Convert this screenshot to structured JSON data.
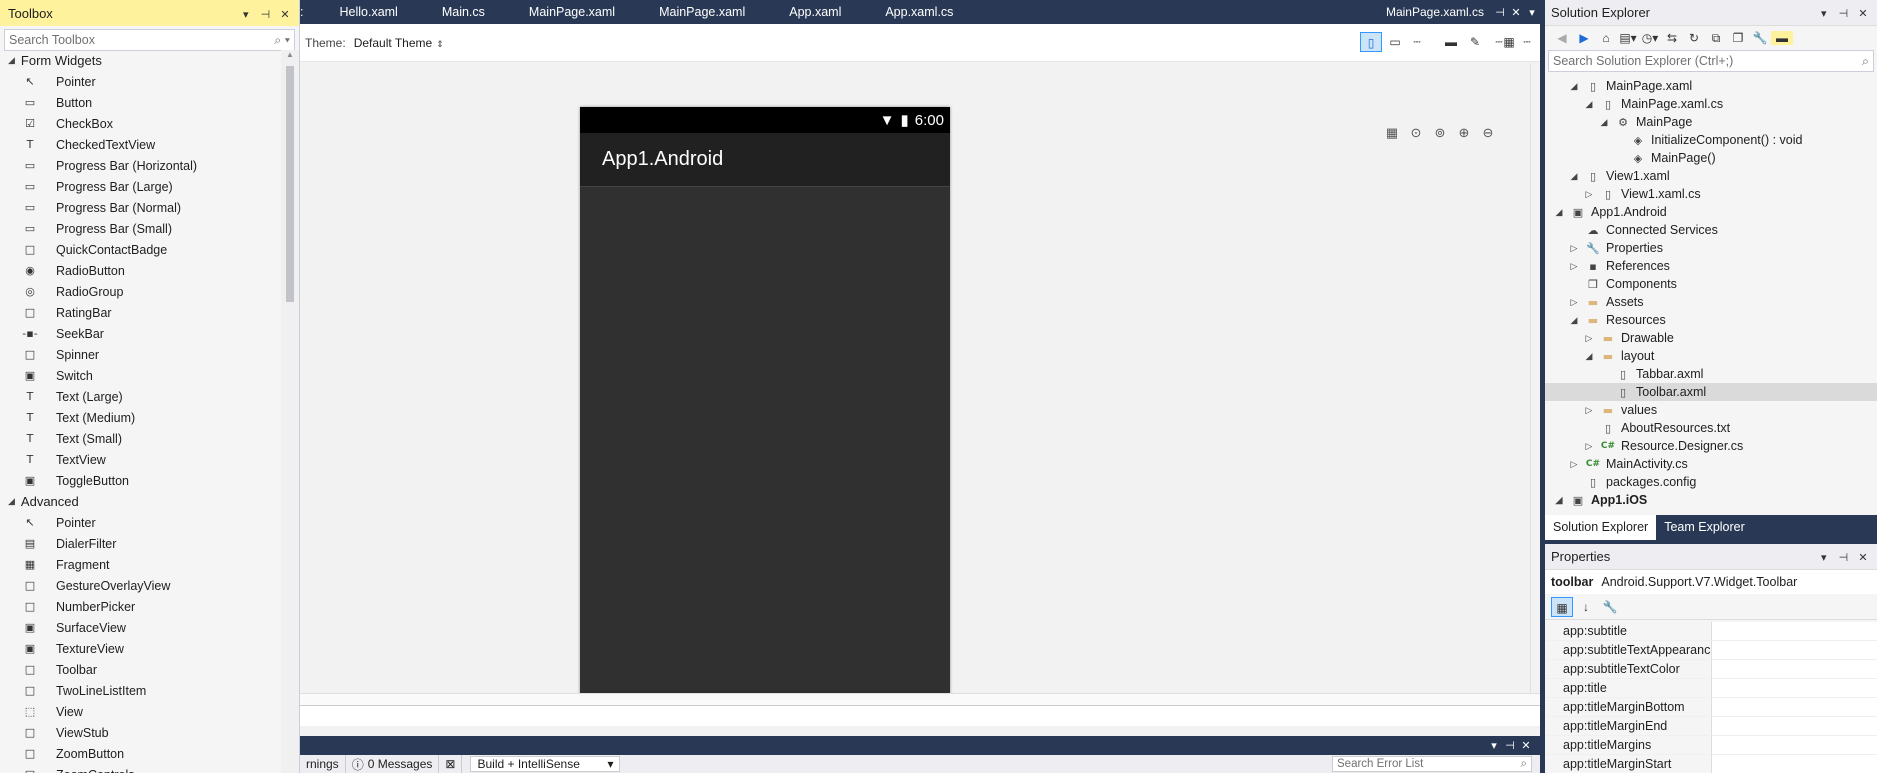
{
  "toolbox": {
    "title": "Toolbox",
    "search_placeholder": "Search Toolbox",
    "categories": [
      {
        "label": "Form Widgets",
        "items": [
          {
            "label": "Pointer",
            "icon": "pointer-icon",
            "glyph": "↖"
          },
          {
            "label": "Button",
            "icon": "button-icon",
            "glyph": "▭"
          },
          {
            "label": "CheckBox",
            "icon": "checkbox-icon",
            "glyph": "☑"
          },
          {
            "label": "CheckedTextView",
            "icon": "text-icon",
            "glyph": "T"
          },
          {
            "label": "Progress Bar (Horizontal)",
            "icon": "progress-bar-icon",
            "glyph": "▭"
          },
          {
            "label": "Progress Bar (Large)",
            "icon": "progress-bar-icon",
            "glyph": "▭"
          },
          {
            "label": "Progress Bar (Normal)",
            "icon": "progress-bar-icon",
            "glyph": "▭"
          },
          {
            "label": "Progress Bar (Small)",
            "icon": "progress-bar-icon",
            "glyph": "▭"
          },
          {
            "label": "QuickContactBadge",
            "icon": "badge-icon",
            "glyph": "□"
          },
          {
            "label": "RadioButton",
            "icon": "radio-icon",
            "glyph": "◉"
          },
          {
            "label": "RadioGroup",
            "icon": "radio-group-icon",
            "glyph": "◎"
          },
          {
            "label": "RatingBar",
            "icon": "rating-icon",
            "glyph": "□"
          },
          {
            "label": "SeekBar",
            "icon": "seekbar-icon",
            "glyph": "-▪-"
          },
          {
            "label": "Spinner",
            "icon": "spinner-icon",
            "glyph": "□"
          },
          {
            "label": "Switch",
            "icon": "switch-icon",
            "glyph": "▣"
          },
          {
            "label": "Text (Large)",
            "icon": "text-icon",
            "glyph": "T"
          },
          {
            "label": "Text (Medium)",
            "icon": "text-icon",
            "glyph": "T"
          },
          {
            "label": "Text (Small)",
            "icon": "text-icon",
            "glyph": "T"
          },
          {
            "label": "TextView",
            "icon": "text-icon",
            "glyph": "T"
          },
          {
            "label": "ToggleButton",
            "icon": "toggle-icon",
            "glyph": "▣"
          }
        ]
      },
      {
        "label": "Advanced",
        "items": [
          {
            "label": "Pointer",
            "icon": "pointer-icon",
            "glyph": "↖"
          },
          {
            "label": "DialerFilter",
            "icon": "dialer-icon",
            "glyph": "▤"
          },
          {
            "label": "Fragment",
            "icon": "fragment-icon",
            "glyph": "▦"
          },
          {
            "label": "GestureOverlayView",
            "icon": "view-icon",
            "glyph": "□"
          },
          {
            "label": "NumberPicker",
            "icon": "view-icon",
            "glyph": "□"
          },
          {
            "label": "SurfaceView",
            "icon": "view-icon",
            "glyph": "▣"
          },
          {
            "label": "TextureView",
            "icon": "view-icon",
            "glyph": "▣"
          },
          {
            "label": "Toolbar",
            "icon": "view-icon",
            "glyph": "□"
          },
          {
            "label": "TwoLineListItem",
            "icon": "view-icon",
            "glyph": "□"
          },
          {
            "label": "View",
            "icon": "view-icon",
            "glyph": "⬚"
          },
          {
            "label": "ViewStub",
            "icon": "view-icon",
            "glyph": "□"
          },
          {
            "label": "ZoomButton",
            "icon": "view-icon",
            "glyph": "□"
          },
          {
            "label": "ZoomControls",
            "icon": "view-icon",
            "glyph": "□"
          }
        ]
      }
    ]
  },
  "doc_tabs": [
    ":",
    "Hello.xaml",
    "Main.cs",
    "MainPage.xaml",
    "MainPage.xaml",
    "App.xaml",
    "App.xaml.cs"
  ],
  "active_file": "MainPage.xaml.cs",
  "designer": {
    "theme_label": "Theme:",
    "theme_value": "Default Theme",
    "phone": {
      "time": "6:00",
      "app_title": "App1.Android"
    }
  },
  "error_list": {
    "warnings_label": "rnings",
    "messages_label": "0 Messages",
    "build_filter": "Build + IntelliSense",
    "search_placeholder": "Search Error List"
  },
  "solution_explorer": {
    "title": "Solution Explorer",
    "search_placeholder": "Search Solution Explorer (Ctrl+;)",
    "nodes": [
      {
        "label": "MainPage.xaml",
        "depth": 2,
        "exp": "◢",
        "icon": "xaml-file-icon",
        "glyph": "▯",
        "cls": ""
      },
      {
        "label": "MainPage.xaml.cs",
        "depth": 3,
        "exp": "◢",
        "icon": "cs-file-icon",
        "glyph": "▯",
        "cls": ""
      },
      {
        "label": "MainPage",
        "depth": 4,
        "exp": "◢",
        "icon": "class-icon",
        "glyph": "⚙",
        "cls": ""
      },
      {
        "label": "InitializeComponent() : void",
        "depth": 5,
        "exp": "",
        "icon": "method-icon",
        "glyph": "◈",
        "cls": ""
      },
      {
        "label": "MainPage()",
        "depth": 5,
        "exp": "",
        "icon": "method-icon",
        "glyph": "◈",
        "cls": ""
      },
      {
        "label": "View1.xaml",
        "depth": 2,
        "exp": "◢",
        "icon": "xaml-file-icon",
        "glyph": "▯",
        "cls": ""
      },
      {
        "label": "View1.xaml.cs",
        "depth": 3,
        "exp": "▷",
        "icon": "cs-file-icon",
        "glyph": "▯",
        "cls": ""
      },
      {
        "label": "App1.Android",
        "depth": 1,
        "exp": "◢",
        "icon": "project-icon",
        "glyph": "▣",
        "cls": ""
      },
      {
        "label": "Connected Services",
        "depth": 2,
        "exp": "",
        "icon": "cloud-icon",
        "glyph": "☁",
        "cls": ""
      },
      {
        "label": "Properties",
        "depth": 2,
        "exp": "▷",
        "icon": "wrench-icon",
        "glyph": "🔧",
        "cls": ""
      },
      {
        "label": "References",
        "depth": 2,
        "exp": "▷",
        "icon": "references-icon",
        "glyph": "▪",
        "cls": ""
      },
      {
        "label": "Components",
        "depth": 2,
        "exp": "",
        "icon": "components-icon",
        "glyph": "❒",
        "cls": ""
      },
      {
        "label": "Assets",
        "depth": 2,
        "exp": "▷",
        "icon": "folder-icon",
        "glyph": "▬",
        "cls": "folder"
      },
      {
        "label": "Resources",
        "depth": 2,
        "exp": "◢",
        "icon": "folder-open-icon",
        "glyph": "▬",
        "cls": "folder"
      },
      {
        "label": "Drawable",
        "depth": 3,
        "exp": "▷",
        "icon": "folder-icon",
        "glyph": "▬",
        "cls": "folder"
      },
      {
        "label": "layout",
        "depth": 3,
        "exp": "◢",
        "icon": "folder-open-icon",
        "glyph": "▬",
        "cls": "folder"
      },
      {
        "label": "Tabbar.axml",
        "depth": 4,
        "exp": "",
        "icon": "file-icon",
        "glyph": "▯",
        "cls": ""
      },
      {
        "label": "Toolbar.axml",
        "depth": 4,
        "exp": "",
        "icon": "file-icon",
        "glyph": "▯",
        "cls": "",
        "selected": true
      },
      {
        "label": "values",
        "depth": 3,
        "exp": "▷",
        "icon": "folder-icon",
        "glyph": "▬",
        "cls": "folder"
      },
      {
        "label": "AboutResources.txt",
        "depth": 3,
        "exp": "",
        "icon": "file-icon",
        "glyph": "▯",
        "cls": ""
      },
      {
        "label": "Resource.Designer.cs",
        "depth": 3,
        "exp": "▷",
        "icon": "cs-file-icon",
        "glyph": "C#",
        "cls": "cs"
      },
      {
        "label": "MainActivity.cs",
        "depth": 2,
        "exp": "▷",
        "icon": "cs-file-icon",
        "glyph": "C#",
        "cls": "cs"
      },
      {
        "label": "packages.config",
        "depth": 2,
        "exp": "",
        "icon": "config-file-icon",
        "glyph": "▯",
        "cls": ""
      },
      {
        "label": "App1.iOS",
        "depth": 1,
        "exp": "◢",
        "icon": "project-icon",
        "glyph": "▣",
        "cls": "",
        "bold": true
      }
    ],
    "tabs": [
      "Solution Explorer",
      "Team Explorer"
    ]
  },
  "properties": {
    "title": "Properties",
    "object_name": "toolbar",
    "object_type": "Android.Support.V7.Widget.Toolbar",
    "rows": [
      "app:subtitle",
      "app:subtitleTextAppearance",
      "app:subtitleTextColor",
      "app:title",
      "app:titleMarginBottom",
      "app:titleMarginEnd",
      "app:titleMargins",
      "app:titleMarginStart"
    ]
  }
}
